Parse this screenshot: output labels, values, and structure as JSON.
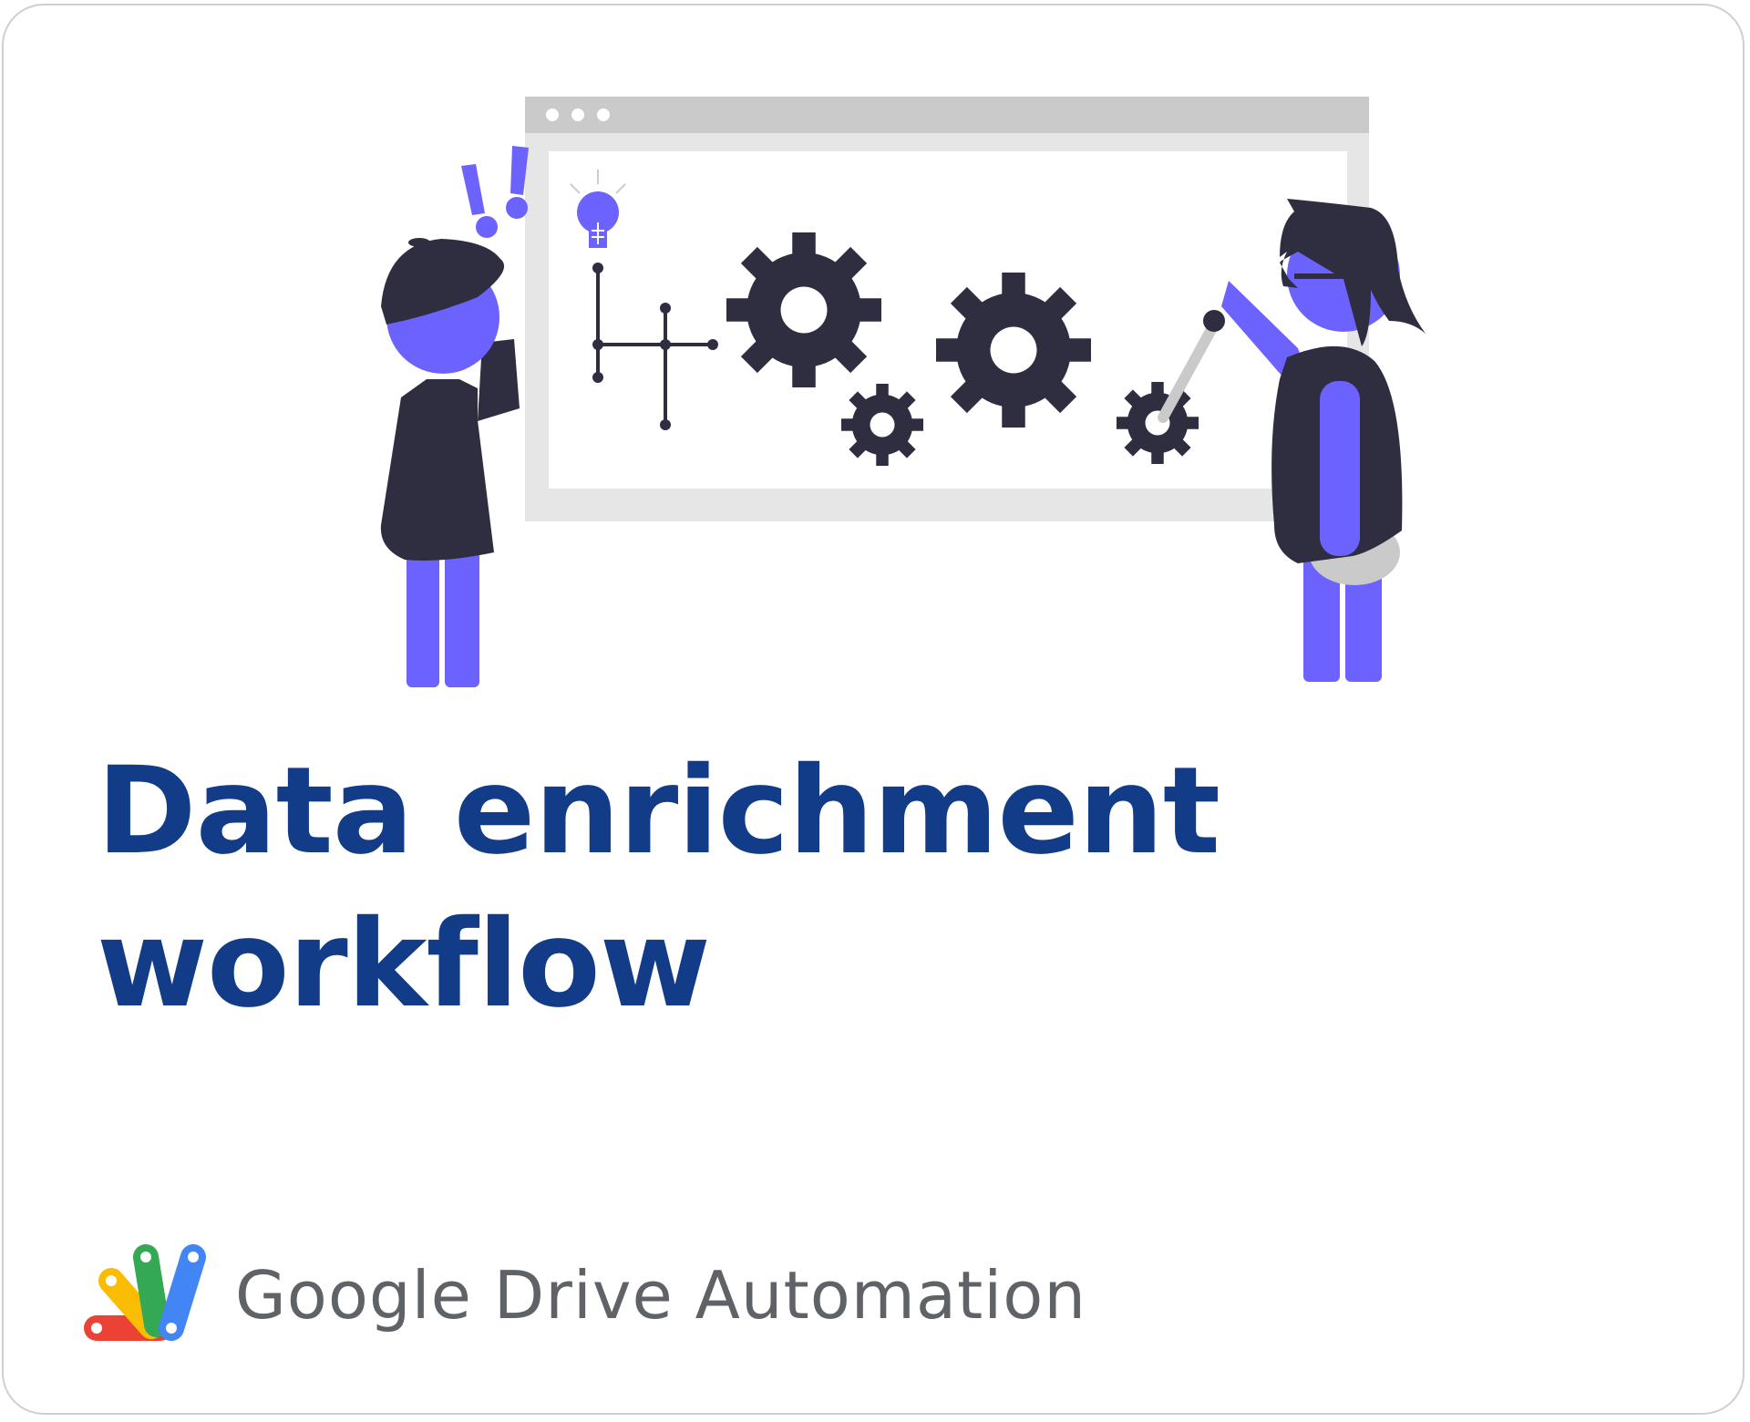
{
  "card": {
    "title": "Data enrichment\nworkflow",
    "brand_name": "Google Drive Automation"
  },
  "illustration": {
    "icons": [
      "browser-window-illustration",
      "exclamation-icon",
      "lightbulb-icon",
      "gear-icon",
      "person-with-cap",
      "person-with-long-hair"
    ]
  },
  "colors": {
    "title": "#123c87",
    "brand_text": "#5f6368",
    "accent_purple": "#6c63ff",
    "dark_navy": "#2f2e41",
    "browser_gray": "#e6e6e6",
    "logo_red": "#ea4335",
    "logo_yellow": "#fbbc04",
    "logo_green": "#34a853",
    "logo_blue": "#4285f4"
  }
}
